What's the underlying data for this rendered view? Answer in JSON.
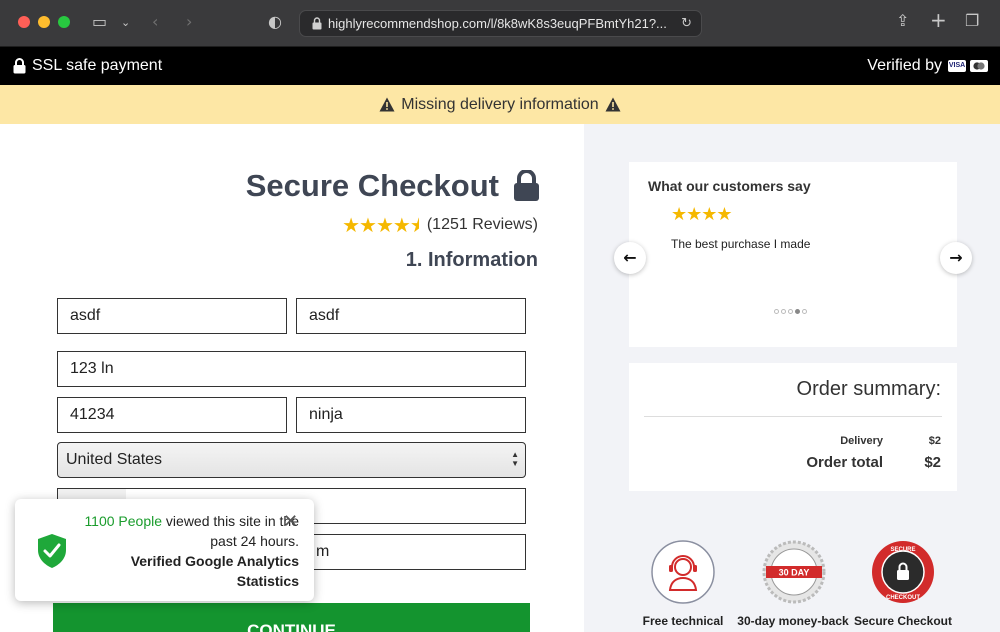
{
  "browser": {
    "url": "highlyrecommendshop.com/l/8k8wK8s3euqPFBmtYh21?..."
  },
  "topbar": {
    "ssl_text": "SSL safe payment",
    "verified_text": "Verified by",
    "card_1": "VISA"
  },
  "warning": {
    "text": "Missing delivery information"
  },
  "checkout": {
    "title": "Secure Checkout",
    "rating_value": 4.5,
    "reviews_text": "(1251 Reviews)",
    "section_title": "1. Information",
    "fields": {
      "first_name": "asdf",
      "last_name": "asdf",
      "address": "123 ln",
      "zip": "41234",
      "city": "ninja",
      "country": "United States",
      "email_suffix": "m"
    },
    "continue_label": "CONTINUE"
  },
  "popup": {
    "count_text": "1100 People",
    "line1_rest": " viewed this site in the",
    "line2": "past 24 hours.",
    "line3": "Verified Google Analytics",
    "line4": "Statistics"
  },
  "testimonial": {
    "title": "What our customers say",
    "stars": "★★★★",
    "text": "The best purchase I made",
    "active_dot": 4,
    "dot_count": 5
  },
  "summary": {
    "title": "Order summary:",
    "delivery_label": "Delivery",
    "delivery_value": "$2",
    "total_label": "Order total",
    "total_value": "$2"
  },
  "badges": {
    "support_label": "Free technical",
    "money_back_label": "30-day money-back",
    "money_back_ribbon": "30 DAY",
    "secure_label": "Secure Checkout",
    "secure_top": "SECURE",
    "secure_bottom": "CHECKOUT"
  },
  "colors": {
    "accent_green": "#14942f",
    "warning_bg": "#fde7a5",
    "star_gold": "#f5b800",
    "badge_red": "#d22b2b"
  }
}
